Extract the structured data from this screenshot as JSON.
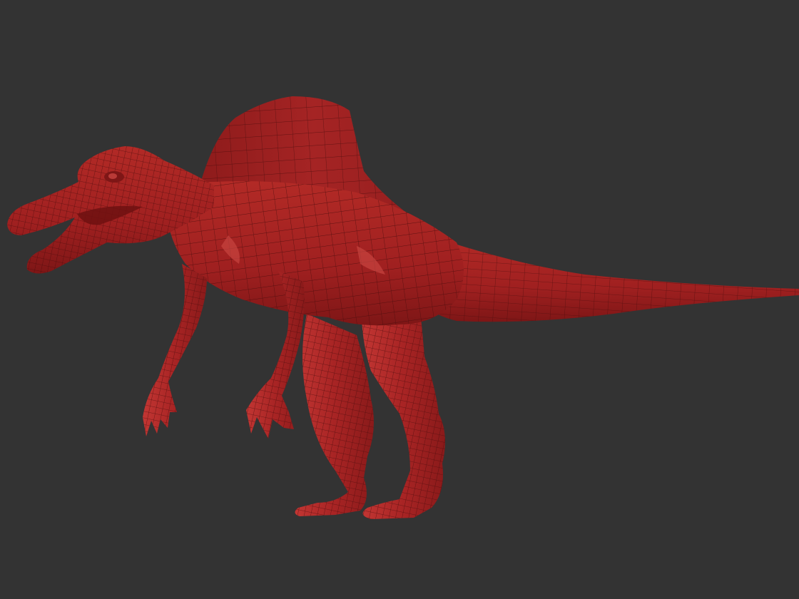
{
  "scene": {
    "background_color": "#333333",
    "model": {
      "subject": "spinosaurus",
      "render_style": "wireframe-polygroup-mesh",
      "base_color": "#a82222",
      "highlight_color": "#c63a36",
      "shadow_color": "#7a1414",
      "wire_color": "#4a0c0c"
    }
  }
}
